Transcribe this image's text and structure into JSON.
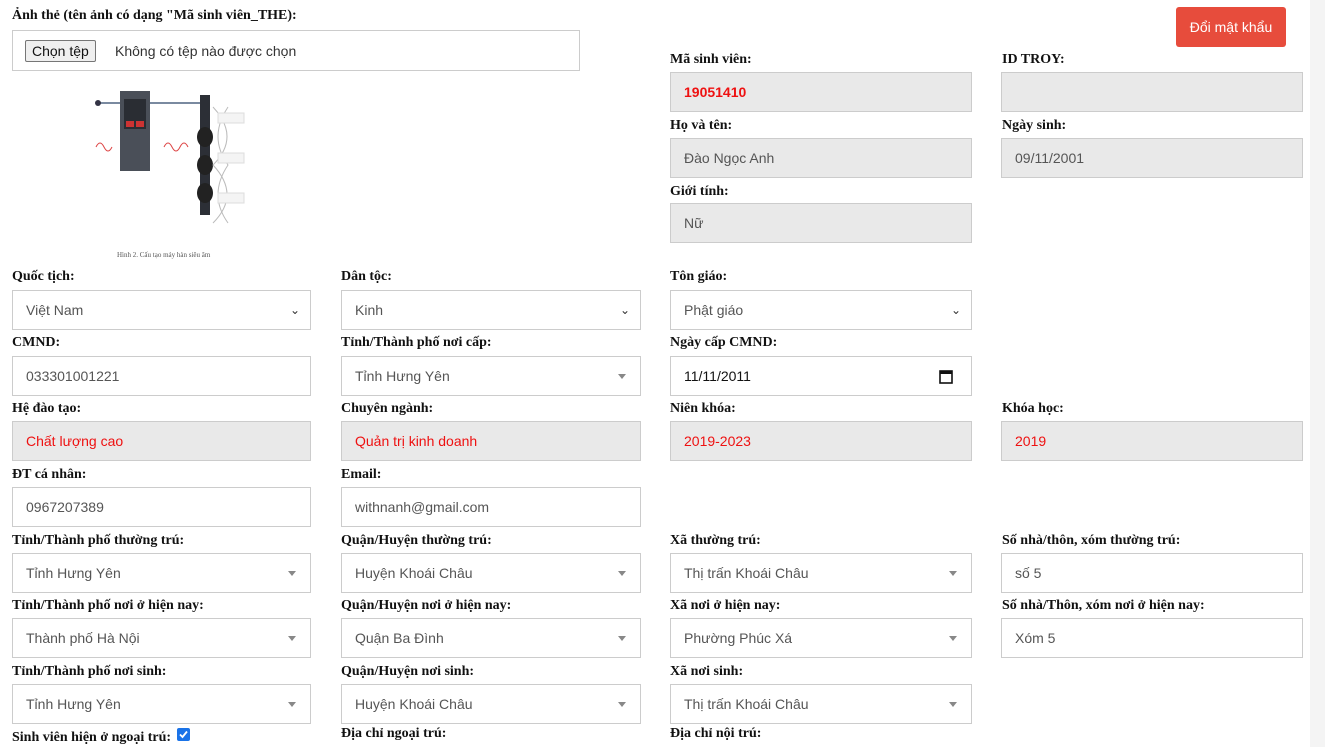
{
  "file_upload": {
    "label": "Ảnh thẻ (tên ảnh có dạng \"Mã sinh viên_THE):",
    "button_label": "Chọn tệp",
    "status": "Không có tệp nào được chọn"
  },
  "photo_caption": "Hình 2. Cấu tạo máy hàn siêu âm",
  "change_password_label": "Đổi mật khẩu",
  "student": {
    "id_label": "Mã sinh viên:",
    "id_value": "19051410",
    "troy_label": "ID TROY:",
    "troy_value": "",
    "name_label": "Họ và tên:",
    "name_value": "Đào Ngọc Anh",
    "dob_label": "Ngày sinh:",
    "dob_value": "09/11/2001",
    "gender_label": "Giới tính:",
    "gender_value": "Nữ"
  },
  "nationality": {
    "label": "Quốc tịch:",
    "value": "Việt Nam"
  },
  "ethnicity": {
    "label": "Dân tộc:",
    "value": "Kinh"
  },
  "religion": {
    "label": "Tôn giáo:",
    "value": "Phật giáo"
  },
  "id_card": {
    "label": "CMND:",
    "value": "033301001221"
  },
  "issue_province": {
    "label": "Tỉnh/Thành phố nơi cấp:",
    "value": "Tỉnh Hưng Yên"
  },
  "issue_date": {
    "label": "Ngày cấp CMND:",
    "value": "11/11/2011"
  },
  "program": {
    "label": "Hệ đào tạo:",
    "value": "Chất lượng cao"
  },
  "major": {
    "label": "Chuyên ngành:",
    "value": "Quản trị kinh doanh"
  },
  "academic_years": {
    "label": "Niên khóa:",
    "value": "2019-2023"
  },
  "cohort": {
    "label": "Khóa học:",
    "value": "2019"
  },
  "phone": {
    "label": "ĐT cá nhân:",
    "value": "0967207389"
  },
  "email": {
    "label": "Email:",
    "value": "withnanh@gmail.com"
  },
  "permanent": {
    "province_label": "Tỉnh/Thành phố thường trú:",
    "province_value": "Tỉnh Hưng Yên",
    "district_label": "Quận/Huyện thường trú:",
    "district_value": "Huyện Khoái Châu",
    "commune_label": "Xã thường trú:",
    "commune_value": "Thị trấn Khoái Châu",
    "house_label": "Số nhà/thôn, xóm thường trú:",
    "house_value": "số 5"
  },
  "current": {
    "province_label": "Tỉnh/Thành phố nơi ở hiện nay:",
    "province_value": "Thành phố Hà Nội",
    "district_label": "Quận/Huyện nơi ở hiện nay:",
    "district_value": "Quận Ba Đình",
    "commune_label": "Xã nơi ở hiện nay:",
    "commune_value": "Phường Phúc Xá",
    "house_label": "Số nhà/Thôn, xóm nơi ở hiện nay:",
    "house_value": "Xóm 5"
  },
  "birthplace": {
    "province_label": "Tỉnh/Thành phố nơi sinh:",
    "province_value": "Tỉnh Hưng Yên",
    "district_label": "Quận/Huyện nơi sinh:",
    "district_value": "Huyện Khoái Châu",
    "commune_label": "Xã nơi sinh:",
    "commune_value": "Thị trấn Khoái Châu"
  },
  "residence": {
    "off_campus_label": "Sinh viên hiện ở ngoại trú:",
    "off_campus_checked": true,
    "off_campus_address_label": "Địa chỉ ngoại trú:",
    "dorm_address_label": "Địa chỉ nội trú:"
  },
  "colors": {
    "accent_button": "#e74c3c",
    "highlight_text": "#ee1111",
    "readonly_bg": "#e9e9e9"
  }
}
